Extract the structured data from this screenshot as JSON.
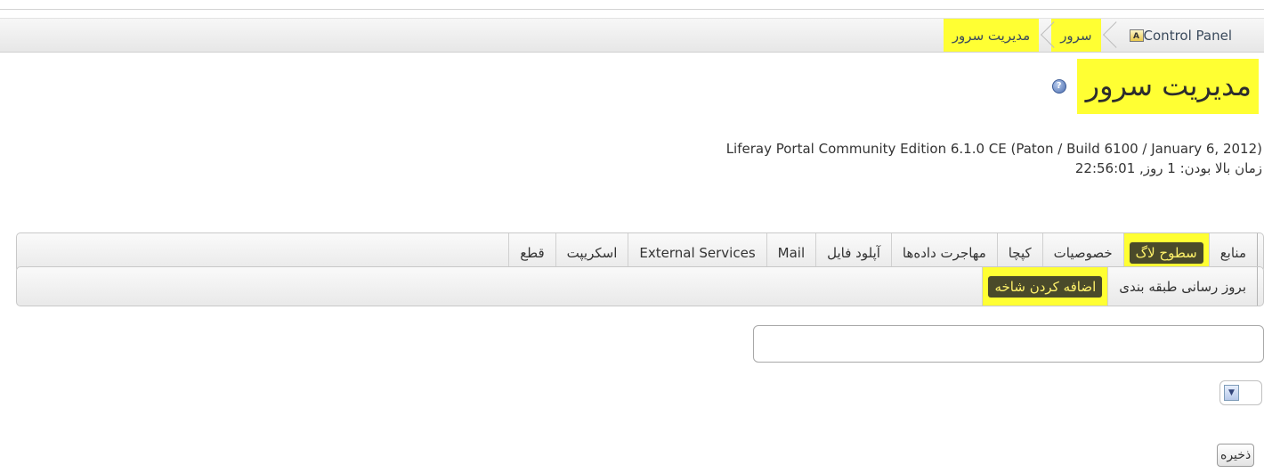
{
  "breadcrumb": {
    "items": [
      {
        "label": "Control Panel",
        "highlighted": false
      },
      {
        "label": "سرور",
        "highlighted": true
      },
      {
        "label": "مدیریت سرور",
        "highlighted": true
      }
    ],
    "control_panel_icon": "control-panel-icon"
  },
  "header": {
    "title": "مدیریت سرور",
    "help_icon": "help-icon",
    "version": "(Liferay Portal Community Edition 6.1.0 CE (Paton / Build 6100 / January 6, 2012",
    "uptime": "زمان بالا بودن: 1 روز, 22:56:01"
  },
  "main_tabs": [
    {
      "label": "منابع",
      "active": false
    },
    {
      "label": "سطوح لاگ",
      "active": true
    },
    {
      "label": "خصوصیات",
      "active": false
    },
    {
      "label": "کپچا",
      "active": false
    },
    {
      "label": "مهاجرت داده‌ها",
      "active": false
    },
    {
      "label": "آپلود فایل",
      "active": false
    },
    {
      "label": "Mail",
      "active": false
    },
    {
      "label": "External Services",
      "active": false
    },
    {
      "label": "اسکریپت",
      "active": false
    },
    {
      "label": "قطع",
      "active": false
    }
  ],
  "sub_tabs": [
    {
      "label": "بروز رسانی طبقه بندی",
      "active": false
    },
    {
      "label": "اضافه کردن شاخه",
      "active": true
    }
  ],
  "form": {
    "category_value": "",
    "priority_selected": "",
    "save_label": "ذخیره"
  },
  "colors": {
    "highlight": "#ffff33",
    "active_pill_bg": "#4a4a2a",
    "active_pill_text": "#fff26a"
  }
}
